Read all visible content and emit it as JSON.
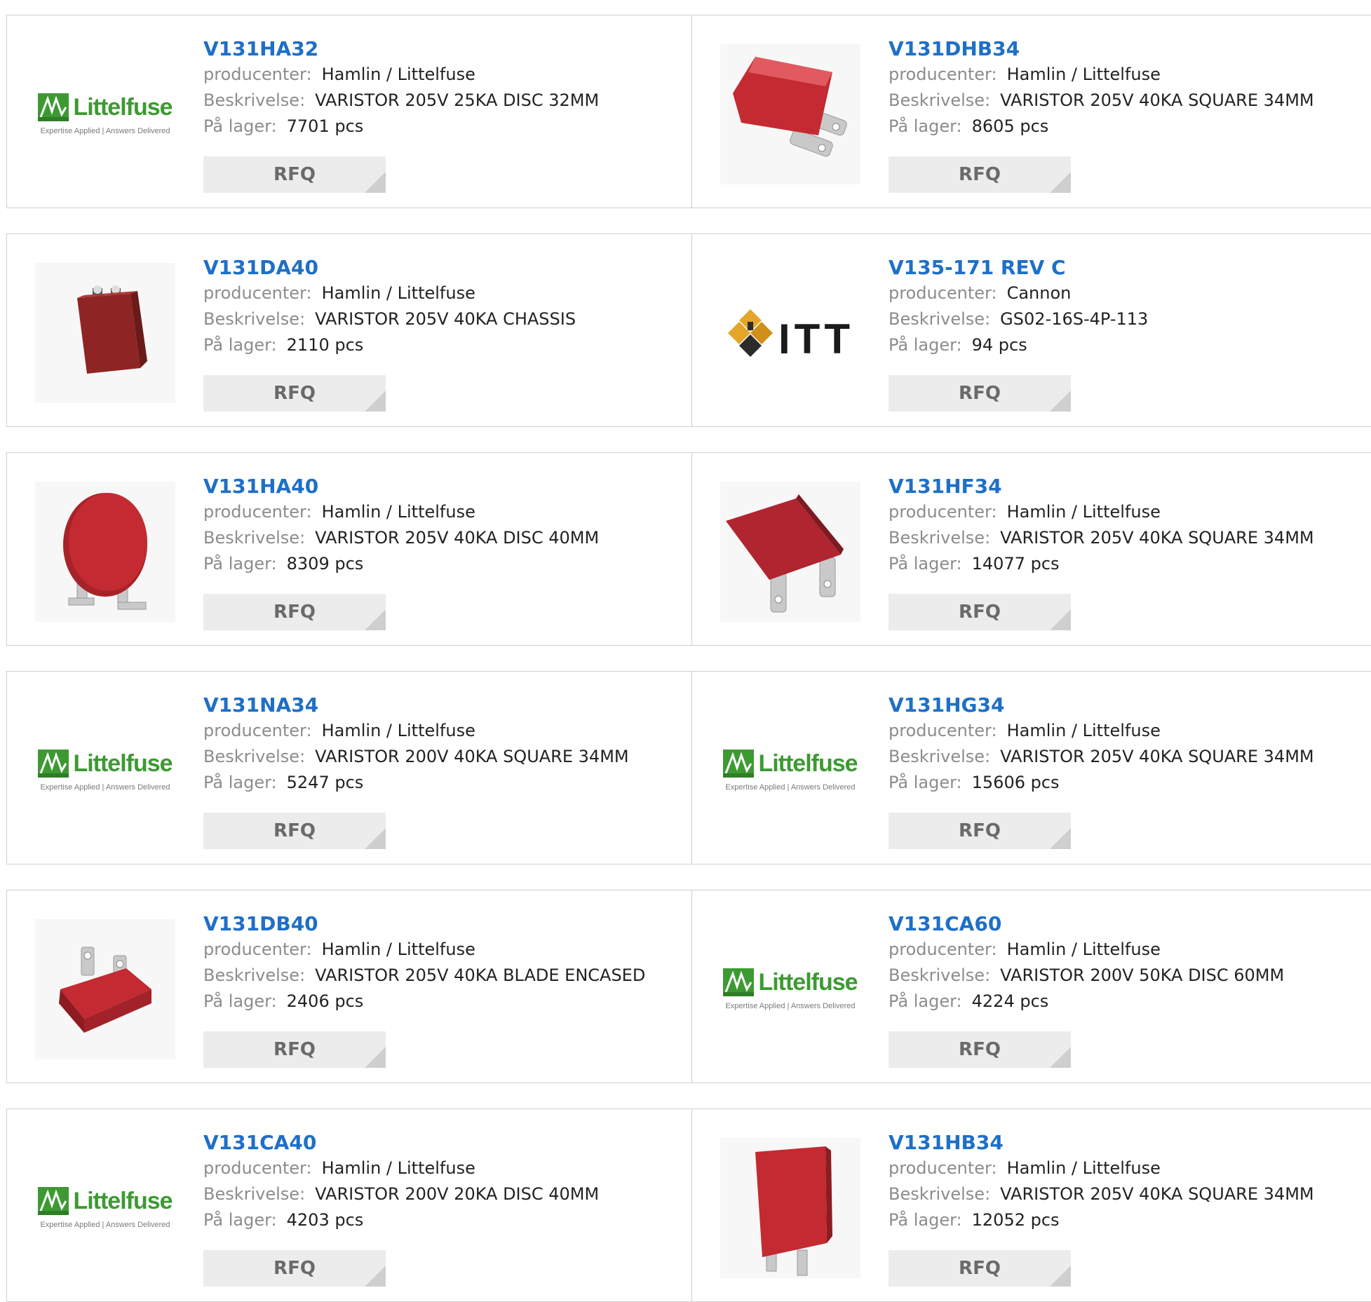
{
  "colors": {
    "part_link": "#1e6fc7",
    "label": "#8c8c8c",
    "value": "#222222",
    "rfq_bg": "#ececec",
    "rfq_text": "#6a6a6a",
    "card_border": "#cfcfcf",
    "littelfuse_green": "#3d9a32",
    "component_red": "#c42a31",
    "itt_gold": "#e3a62a"
  },
  "labels": {
    "manufacturer": "producenter:",
    "description": "Beskrivelse:",
    "stock": "På lager:",
    "rfq": "RFQ"
  },
  "logos": {
    "littelfuse_name": "Littelfuse",
    "littelfuse_tagline": "Expertise Applied | Answers Delivered",
    "itt_name": "ITT"
  },
  "products": [
    {
      "part": "V131HA32",
      "manufacturer": "Hamlin / Littelfuse",
      "description": "VARISTOR 205V 25KA DISC 32MM",
      "stock": "7701 pcs",
      "image": "littelfuse-logo"
    },
    {
      "part": "V131DHB34",
      "manufacturer": "Hamlin / Littelfuse",
      "description": "VARISTOR 205V 40KA SQUARE 34MM",
      "stock": "8605 pcs",
      "image": "square-varistor-flat"
    },
    {
      "part": "V131DA40",
      "manufacturer": "Hamlin / Littelfuse",
      "description": "VARISTOR 205V 40KA CHASSIS",
      "stock": "2110 pcs",
      "image": "chassis-varistor"
    },
    {
      "part": "V135-171 REV C",
      "manufacturer": "Cannon",
      "description": "GS02-16S-4P-113",
      "stock": "94 pcs",
      "image": "itt-logo"
    },
    {
      "part": "V131HA40",
      "manufacturer": "Hamlin / Littelfuse",
      "description": "VARISTOR 205V 40KA DISC 40MM",
      "stock": "8309 pcs",
      "image": "disc-varistor"
    },
    {
      "part": "V131HF34",
      "manufacturer": "Hamlin / Littelfuse",
      "description": "VARISTOR 205V 40KA SQUARE 34MM",
      "stock": "14077 pcs",
      "image": "square-varistor-angled"
    },
    {
      "part": "V131NA34",
      "manufacturer": "Hamlin / Littelfuse",
      "description": "VARISTOR 200V 40KA SQUARE 34MM",
      "stock": "5247 pcs",
      "image": "littelfuse-logo"
    },
    {
      "part": "V131HG34",
      "manufacturer": "Hamlin / Littelfuse",
      "description": "VARISTOR 205V 40KA SQUARE 34MM",
      "stock": "15606 pcs",
      "image": "littelfuse-logo"
    },
    {
      "part": "V131DB40",
      "manufacturer": "Hamlin / Littelfuse",
      "description": "VARISTOR 205V 40KA BLADE ENCASED",
      "stock": "2406 pcs",
      "image": "blade-varistor"
    },
    {
      "part": "V131CA60",
      "manufacturer": "Hamlin / Littelfuse",
      "description": "VARISTOR 200V 50KA DISC 60MM",
      "stock": "4224 pcs",
      "image": "littelfuse-logo"
    },
    {
      "part": "V131CA40",
      "manufacturer": "Hamlin / Littelfuse",
      "description": "VARISTOR 200V 20KA DISC 40MM",
      "stock": "4203 pcs",
      "image": "littelfuse-logo"
    },
    {
      "part": "V131HB34",
      "manufacturer": "Hamlin / Littelfuse",
      "description": "VARISTOR 205V 40KA SQUARE 34MM",
      "stock": "12052 pcs",
      "image": "square-varistor-upright"
    }
  ]
}
